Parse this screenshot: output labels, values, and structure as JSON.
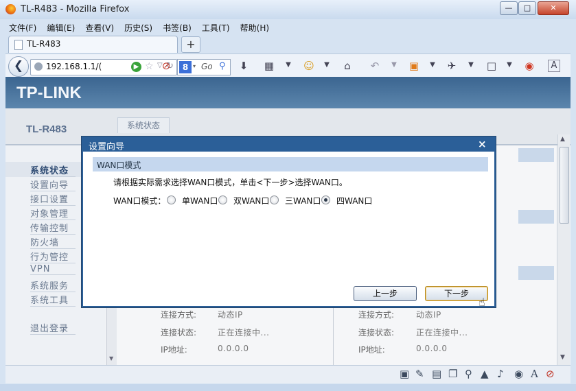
{
  "window": {
    "title": "TL-R483 - Mozilla Firefox",
    "minimize": "—",
    "maximize": "□",
    "close": "✕"
  },
  "menu": [
    "文件(F)",
    "编辑(E)",
    "查看(V)",
    "历史(S)",
    "书签(B)",
    "工具(T)",
    "帮助(H)"
  ],
  "tab": {
    "label": "TL-R483",
    "new_tab": "+"
  },
  "nav": {
    "url": "192.168.1.1/(",
    "search_engine": "8",
    "search_go": "Go",
    "icons": [
      "back-icon",
      "globe-icon",
      "go-icon",
      "star-icon",
      "dropdown-icon",
      "reload-icon",
      "adblock-icon",
      "google-search-icon",
      "download-icon",
      "screenshot-icon",
      "emoji-icon",
      "home-icon",
      "undo-icon",
      "addon-icon",
      "spy-icon",
      "crop-icon",
      "weibo-icon",
      "text-icon"
    ]
  },
  "page": {
    "logo": "TP-LINK",
    "model": "TL-R483",
    "status_tab": "系统状态",
    "sidebar": [
      "系统状态",
      "设置向导",
      "接口设置",
      "对象管理",
      "传输控制",
      "防火墙",
      "行为管控",
      "VPN",
      "系统服务",
      "系统工具",
      "退出登录"
    ],
    "left_info": [
      {
        "label": "连接方式:",
        "value": "动态IP"
      },
      {
        "label": "连接状态:",
        "value": "正在连接中..."
      },
      {
        "label": "IP地址:",
        "value": "0.0.0.0"
      }
    ],
    "right_info": [
      {
        "label": "连接方式:",
        "value": "动态IP"
      },
      {
        "label": "连接状态:",
        "value": "正在连接中..."
      },
      {
        "label": "IP地址:",
        "value": "0.0.0.0"
      }
    ]
  },
  "dialog": {
    "title": "设置向导",
    "close": "×",
    "section_title": "WAN口模式",
    "instruction": "请根据实际需求选择WAN口模式，单击<下一步>选择WAN口。",
    "wan_label": "WAN口模式：",
    "options": [
      "单WAN口",
      "双WAN口",
      "三WAN口",
      "四WAN口"
    ],
    "selected_option": "四WAN口",
    "prev_button": "上一步",
    "next_button": "下一步"
  },
  "statusbar_icons": [
    "restore-icon",
    "pen-icon",
    "window-icon",
    "search-icon",
    "shirt-icon",
    "volume-icon",
    "camera-icon",
    "font-icon",
    "adblock-icon"
  ]
}
